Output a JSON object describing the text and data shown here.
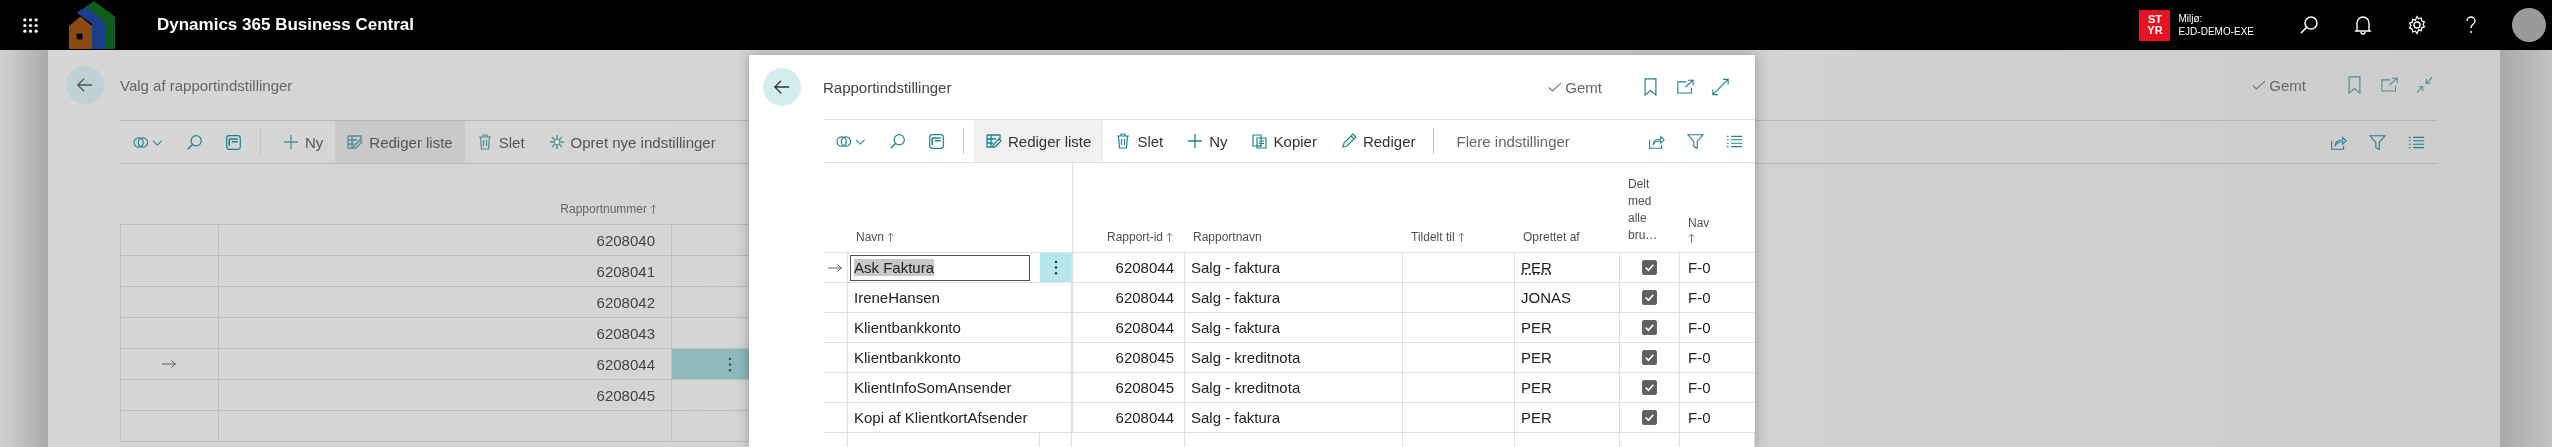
{
  "top_bar": {
    "app_title": "Dynamics 365 Business Central",
    "environment_badge": [
      "ST",
      "YR"
    ],
    "environment_label": "Miljø:",
    "environment_name": "EJD-DEMO-EXE"
  },
  "background_page": {
    "title": "Valg af rapportindstillinger",
    "save_status": "Gemt",
    "actions": [
      {
        "kind": "new",
        "label": "Ny",
        "selected": false
      },
      {
        "kind": "edit_list",
        "label": "Rediger liste",
        "selected": true
      },
      {
        "kind": "delete",
        "label": "Slet",
        "selected": false
      },
      {
        "kind": "create",
        "label": "Opret nye indstillinger",
        "selected": false
      }
    ],
    "table": {
      "column": {
        "label": "Rapportnummer",
        "sorted": true
      },
      "rows": [
        {
          "report_number": "6208040",
          "selected": false
        },
        {
          "report_number": "6208041",
          "selected": false
        },
        {
          "report_number": "6208042",
          "selected": false
        },
        {
          "report_number": "6208043",
          "selected": false
        },
        {
          "report_number": "6208044",
          "selected": true
        },
        {
          "report_number": "6208045",
          "selected": false
        }
      ]
    }
  },
  "dialog": {
    "title": "Rapportindstillinger",
    "save_status": "Gemt",
    "actions": [
      {
        "kind": "edit_list",
        "label": "Rediger liste",
        "selected": true
      },
      {
        "kind": "delete",
        "label": "Slet",
        "selected": false
      },
      {
        "kind": "new",
        "label": "Ny",
        "selected": false
      },
      {
        "kind": "copy",
        "label": "Kopier",
        "selected": false
      },
      {
        "kind": "edit",
        "label": "Rediger",
        "selected": false
      },
      {
        "kind": "more",
        "label": "Flere indstillinger",
        "selected": false
      }
    ],
    "table": {
      "columns": [
        {
          "label": "Navn",
          "sorted": true,
          "kind": "text"
        },
        {
          "label": "Rapport-id",
          "sorted": true,
          "kind": "number"
        },
        {
          "label": "Rapportnavn",
          "sorted": false,
          "kind": "text"
        },
        {
          "label": "Tildelt til",
          "sorted": true,
          "kind": "text"
        },
        {
          "label": "Oprettet af",
          "sorted": false,
          "kind": "text"
        },
        {
          "label": "Delt med alle bru…",
          "sorted": false,
          "kind": "check"
        },
        {
          "label": "Nav",
          "sorted": true,
          "kind": "text"
        }
      ],
      "rows": [
        {
          "selected": true,
          "name": "Ask Faktura",
          "report_id": "6208044",
          "report_name": "Salg - faktura",
          "created_by": "PER",
          "shared": true,
          "column_7": "F-0"
        },
        {
          "selected": false,
          "name": "IreneHansen",
          "report_id": "6208044",
          "report_name": "Salg - faktura",
          "created_by": "JONAS",
          "shared": true,
          "column_7": "F-0"
        },
        {
          "selected": false,
          "name": "Klientbankkonto",
          "report_id": "6208044",
          "report_name": "Salg - faktura",
          "created_by": "PER",
          "shared": true,
          "column_7": "F-0"
        },
        {
          "selected": false,
          "name": "Klientbankkonto",
          "report_id": "6208045",
          "report_name": "Salg - kreditnota",
          "created_by": "PER",
          "shared": true,
          "column_7": "F-0"
        },
        {
          "selected": false,
          "name": "KlientInfoSomAnsender",
          "report_id": "6208045",
          "report_name": "Salg - kreditnota",
          "created_by": "PER",
          "shared": true,
          "column_7": "F-0"
        },
        {
          "selected": false,
          "name": "Kopi af KlientkortAfsender",
          "report_id": "6208044",
          "report_name": "Salg - faktura",
          "created_by": "PER",
          "shared": true,
          "column_7": "F-0"
        }
      ]
    }
  }
}
